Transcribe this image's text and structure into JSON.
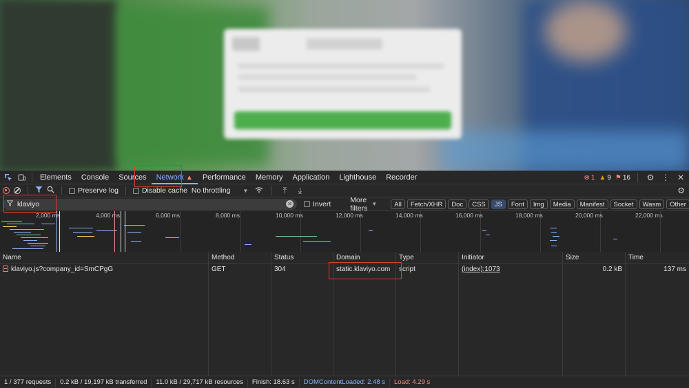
{
  "devtools": {
    "tabs": [
      {
        "label": "Elements"
      },
      {
        "label": "Console"
      },
      {
        "label": "Sources"
      },
      {
        "label": "Network"
      },
      {
        "label": "Performance"
      },
      {
        "label": "Memory"
      },
      {
        "label": "Application"
      },
      {
        "label": "Lighthouse"
      },
      {
        "label": "Recorder"
      }
    ],
    "active_tab": "Network",
    "counts": {
      "errors": "1",
      "warnings": "9",
      "issues": "16"
    }
  },
  "toolbar": {
    "preserve_log": "Preserve log",
    "disable_cache": "Disable cache",
    "throttling": "No throttling"
  },
  "filter": {
    "value": "klaviyo",
    "invert": "Invert",
    "more_filters": "More filters",
    "types": [
      "All",
      "Fetch/XHR",
      "Doc",
      "CSS",
      "JS",
      "Font",
      "Img",
      "Media",
      "Manifest",
      "Socket",
      "Wasm",
      "Other"
    ],
    "selected_type": "JS"
  },
  "overview": {
    "ticks": [
      "2,000 ms",
      "4,000 ms",
      "6,000 ms",
      "8,000 ms",
      "10,000 ms",
      "12,000 ms",
      "14,000 ms",
      "16,000 ms",
      "18,000 ms",
      "20,000 ms",
      "22,000 ms"
    ]
  },
  "table": {
    "headers": [
      "Name",
      "Method",
      "Status",
      "Domain",
      "Type",
      "Initiator",
      "Size",
      "Time"
    ],
    "rows": [
      {
        "name": "klaviyo.js?company_id=SmCPgG",
        "method": "GET",
        "status": "304",
        "domain": "static.klaviyo.com",
        "type": "script",
        "initiator": "(index):1073",
        "size": "0.2 kB",
        "time": "137 ms"
      }
    ]
  },
  "status": {
    "requests": "1 / 377 requests",
    "transferred": "0.2 kB / 19,197 kB transferred",
    "resources": "11.0 kB / 29,717 kB resources",
    "finish": "Finish: 18.63 s",
    "dcl": "DOMContentLoaded: 2.48 s",
    "load": "Load: 4.29 s"
  },
  "colors": {
    "accent": "#8ab4f8",
    "highlight": "#e03c31",
    "error": "#f28b82"
  }
}
